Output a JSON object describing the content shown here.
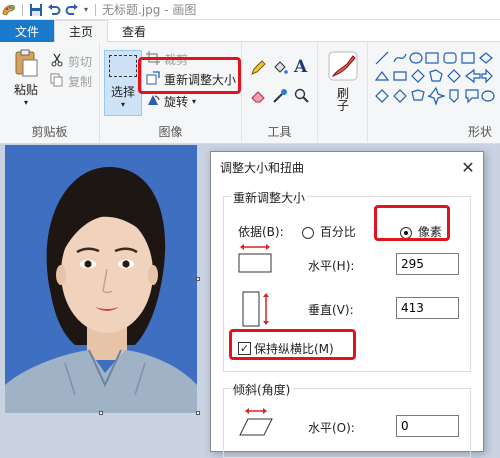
{
  "titlebar": {
    "title": "无标题.jpg - 画图"
  },
  "tabs": {
    "file": "文件",
    "home": "主页",
    "view": "查看"
  },
  "ribbon": {
    "clipboard": {
      "paste": "粘贴",
      "cut": "剪切",
      "copy": "复制",
      "label": "剪贴板"
    },
    "image": {
      "select": "选择",
      "crop": "裁剪",
      "resize": "重新调整大小",
      "rotate": "旋转",
      "label": "图像"
    },
    "tools": {
      "label": "工具"
    },
    "brushes": {
      "label": "刷子"
    },
    "shapes": {
      "label": "形状"
    }
  },
  "dialog": {
    "title": "调整大小和扭曲",
    "resize_group": "重新调整大小",
    "by_label": "依据(B):",
    "percent": "百分比",
    "pixels": "像素",
    "horizontal_label": "水平(H):",
    "horizontal_value": "295",
    "vertical_label": "垂直(V):",
    "vertical_value": "413",
    "keep_ratio": "保持纵横比(M)",
    "skew_group": "倾斜(角度)",
    "skew_horizontal_label": "水平(O):",
    "skew_horizontal_value": "0"
  },
  "colors": {
    "accent": "#1979ca",
    "highlight": "#e0141e",
    "photo_bg": "#3e6fc1"
  }
}
